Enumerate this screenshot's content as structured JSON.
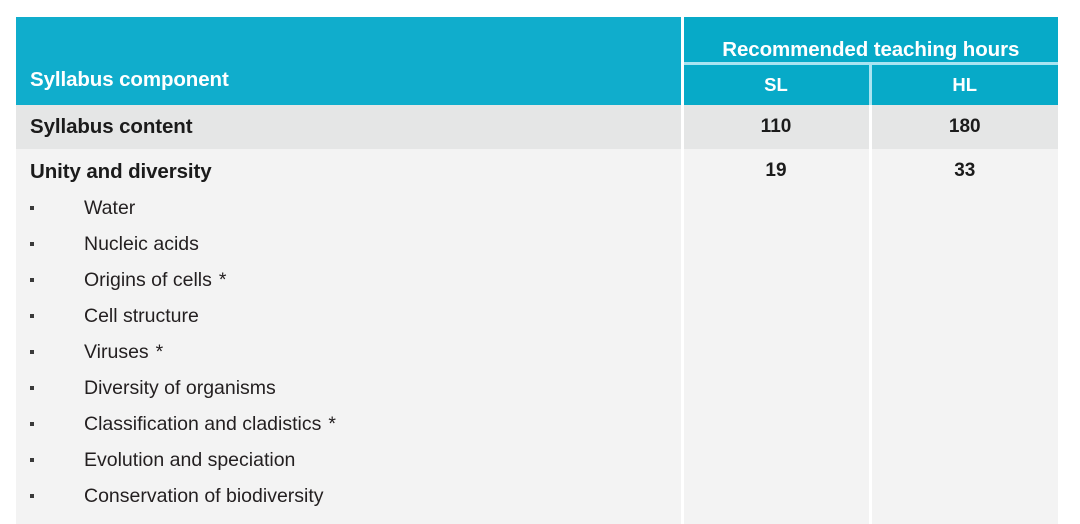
{
  "table": {
    "headers": {
      "component": "Syllabus component",
      "group": "Recommended teaching hours",
      "sl": "SL",
      "hl": "HL"
    },
    "total_row": {
      "label": "Syllabus content",
      "sl": "110",
      "hl": "180"
    },
    "section": {
      "label": "Unity and diversity",
      "sl": "19",
      "hl": "33",
      "items": [
        {
          "text": "Water",
          "marker": ""
        },
        {
          "text": "Nucleic acids",
          "marker": ""
        },
        {
          "text": "Origins of cells",
          "marker": "*"
        },
        {
          "text": "Cell structure",
          "marker": ""
        },
        {
          "text": "Viruses",
          "marker": "*"
        },
        {
          "text": "Diversity of organisms",
          "marker": ""
        },
        {
          "text": "Classification and cladistics",
          "marker": "*"
        },
        {
          "text": "Evolution and speciation",
          "marker": ""
        },
        {
          "text": "Conservation of biodiversity",
          "marker": ""
        }
      ]
    }
  },
  "colors": {
    "header_left": "#10adcc",
    "header_right": "#07aac8",
    "header_rule": "#a9e4f1",
    "total_row_bg": "#e5e6e6",
    "body_bg": "#f3f3f3",
    "text_dark": "#1b1b1b"
  }
}
